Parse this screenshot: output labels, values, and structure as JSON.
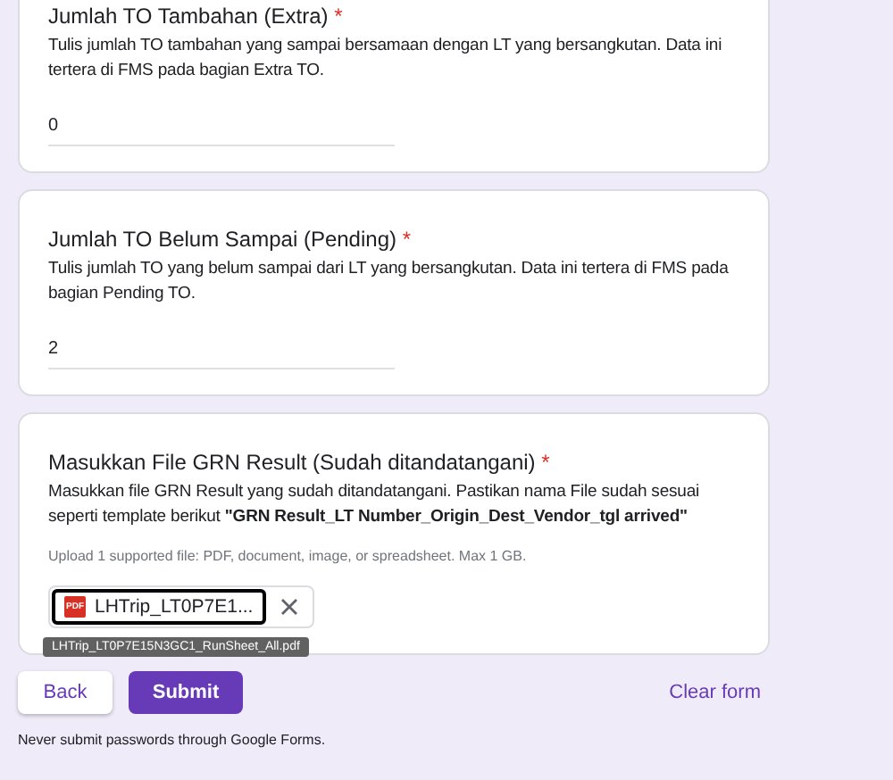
{
  "questions": [
    {
      "kind": "number",
      "title": "Jumlah TO Tambahan (Extra)",
      "required_mark": "*",
      "description": "Tulis jumlah TO tambahan yang sampai bersamaan dengan LT yang bersangkutan. Data ini  tertera di FMS pada bagian Extra TO.",
      "value": "0"
    },
    {
      "kind": "number",
      "title": "Jumlah TO Belum Sampai (Pending)",
      "required_mark": "*",
      "description": "Tulis jumlah TO yang belum sampai dari LT yang bersangkutan. Data ini  tertera di FMS pada bagian Pending TO.",
      "value": "2"
    },
    {
      "kind": "file",
      "title": "Masukkan File GRN Result (Sudah ditandatangani)",
      "required_mark": "*",
      "description": "Masukkan file GRN Result yang sudah ditandatangani. Pastikan nama File sudah sesuai seperti template berikut **\"GRN Result_LT Number_Origin_Dest_Vendor_tgl arrived\"**",
      "hint": "Upload 1 supported file: PDF, document, image, or spreadsheet. Max 1 GB.",
      "file": {
        "badge": "PDF",
        "name": "LHTrip_LT0P7E1...",
        "tooltip": "LHTrip_LT0P7E15N3GC1_RunSheet_All.pdf"
      }
    }
  ],
  "buttons": {
    "back": "Back",
    "submit": "Submit",
    "clear": "Clear form"
  },
  "footer": "Never submit passwords through Google Forms."
}
